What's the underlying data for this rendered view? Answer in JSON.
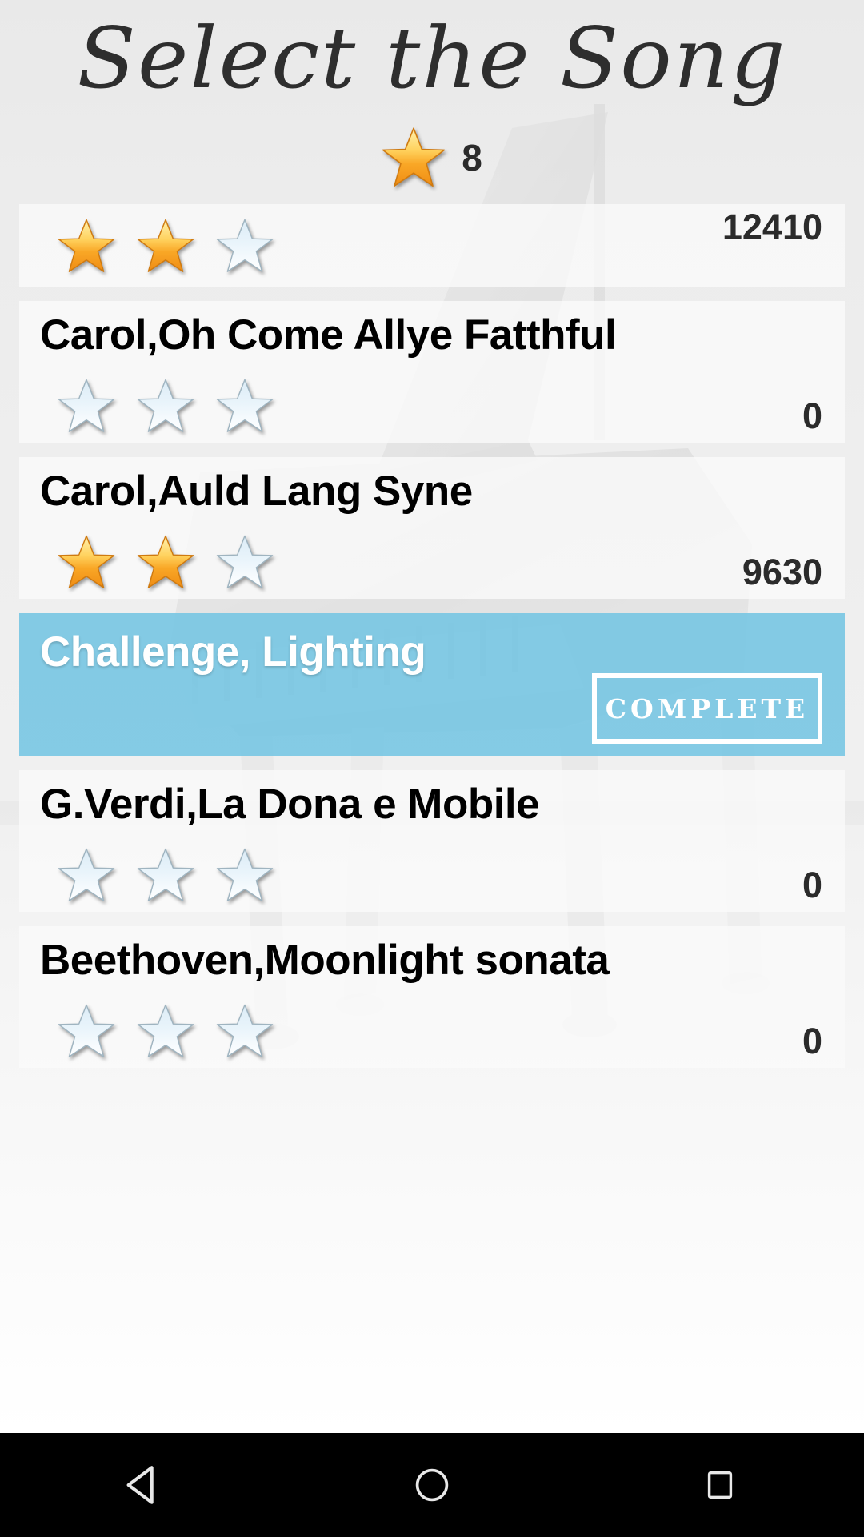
{
  "screen": {
    "title": "Select the Song",
    "background_color": "#ececec",
    "accent_color": "#74c5e3",
    "star_gold_top": "#ffe680",
    "star_gold_bottom": "#f29020",
    "star_empty_top": "#e4f2fa",
    "star_empty_bottom": "#ffffff"
  },
  "header": {
    "star_icon": "star-filled-icon",
    "star_count": "8"
  },
  "songs": [
    {
      "title": "",
      "title_visible": false,
      "stars_filled": 2,
      "stars_total": 3,
      "score": "12410",
      "selected": false,
      "badge": ""
    },
    {
      "title": "Carol,Oh Come Allye Fatthful",
      "title_visible": true,
      "stars_filled": 0,
      "stars_total": 3,
      "score": "0",
      "selected": false,
      "badge": ""
    },
    {
      "title": "Carol,Auld Lang Syne",
      "title_visible": true,
      "stars_filled": 2,
      "stars_total": 3,
      "score": "9630",
      "selected": false,
      "badge": ""
    },
    {
      "title": "Challenge, Lighting",
      "title_visible": true,
      "stars_filled": 0,
      "stars_total": 0,
      "score": "",
      "selected": true,
      "badge": "COMPLETE"
    },
    {
      "title": "G.Verdi,La Dona e Mobile",
      "title_visible": true,
      "stars_filled": 0,
      "stars_total": 3,
      "score": "0",
      "selected": false,
      "badge": ""
    },
    {
      "title": "Beethoven,Moonlight sonata",
      "title_visible": true,
      "stars_filled": 0,
      "stars_total": 3,
      "score": "0",
      "selected": false,
      "badge": ""
    }
  ],
  "navbar": {
    "back_icon": "back-triangle-icon",
    "home_icon": "home-circle-icon",
    "recents_icon": "recents-square-icon"
  }
}
